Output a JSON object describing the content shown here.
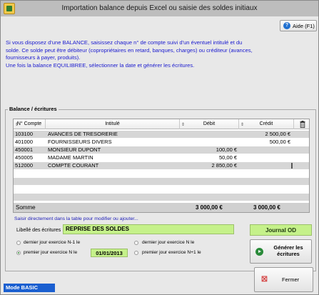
{
  "window": {
    "title": "Importation balance depuis Excel ou saisie des soldes initiaux"
  },
  "help": {
    "label": "Aide (F1)"
  },
  "info": {
    "lines": [
      "Si vous disposez d'une BALANCE, saisissez chaque n° de compte suivi d'un éventuel intitulé et du",
      "solde. Ce solde peut être débiteur (copropriétaires en retard, banques, charges) ou créditeur (avances,",
      "fournisseurs à payer, produits).",
      "Une fois la balance EQUILIBREE, sélectionner la date et générer les écritures."
    ]
  },
  "group": {
    "label": "Balance / écritures"
  },
  "table": {
    "headers": {
      "account": "N° Compte",
      "label": "Intitulé",
      "debit": "Débit",
      "credit": "Crédit"
    },
    "rows": [
      {
        "account": "103100",
        "label": "AVANCES DE TRESORERIE",
        "debit": "",
        "credit": "2 500,00 €"
      },
      {
        "account": "401000",
        "label": "FOURNISSEURS DIVERS",
        "debit": "",
        "credit": "500,00 €"
      },
      {
        "account": "450001",
        "label": "MONSIEUR DUPONT",
        "debit": "100,00 €",
        "credit": ""
      },
      {
        "account": "450005",
        "label": "MADAME MARTIN",
        "debit": "50,00 €",
        "credit": ""
      },
      {
        "account": "512000",
        "label": "COMPTE COURANT",
        "debit": "2 850,00 €",
        "credit": ""
      },
      {
        "account": "",
        "label": "",
        "debit": "",
        "credit": ""
      },
      {
        "account": "",
        "label": "",
        "debit": "",
        "credit": ""
      },
      {
        "account": "",
        "label": "",
        "debit": "",
        "credit": ""
      },
      {
        "account": "",
        "label": "",
        "debit": "",
        "credit": ""
      },
      {
        "account": "",
        "label": "",
        "debit": "",
        "credit": ""
      }
    ],
    "sum": {
      "label": "Somme",
      "debit": "3 000,00 €",
      "credit": "3 000,00 €"
    }
  },
  "hint": "Saisir directement dans la table pour modifier ou ajouter...",
  "libelle": {
    "label": "Libellé des écritures",
    "value": "REPRISE DES SOLDES"
  },
  "journal": "Journal OD",
  "options": {
    "last_day_n1": "dernier jour exercice N-1 le",
    "last_day_n": "dernier jour exercice N le",
    "first_day_n": "premier jour exercice N le",
    "first_day_n1": "premier jour exercice N+1 le",
    "date": "01/01/2013"
  },
  "generate": {
    "label_line1": "Générer les",
    "label_line2": "écritures"
  },
  "mode": "Mode BASIC",
  "close": {
    "label": "Fermer"
  }
}
